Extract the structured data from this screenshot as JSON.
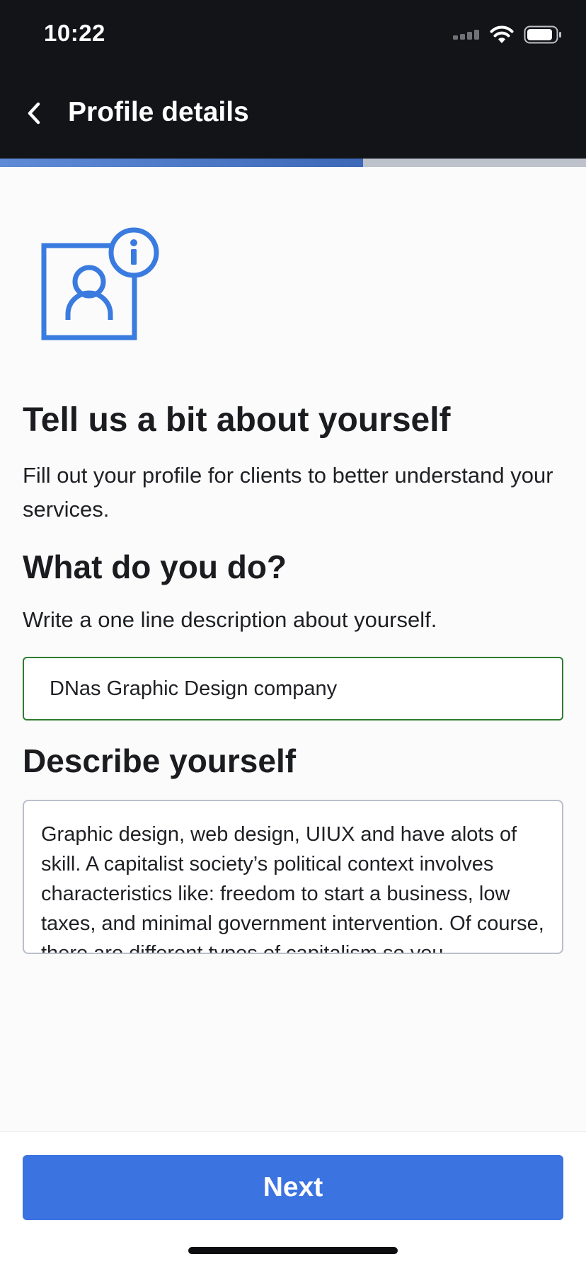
{
  "status_bar": {
    "time": "10:22"
  },
  "header": {
    "title": "Profile details",
    "back_icon": "chevron-left-icon"
  },
  "progress": {
    "fraction": 0.62,
    "fill_color": "#3d68b8",
    "track_color": "#bec2cb"
  },
  "hero": {
    "icon": "profile-info-icon",
    "color": "#3a7bdf"
  },
  "main": {
    "title": "Tell us a bit about yourself",
    "intro": "Fill out your profile for clients to better understand your services.",
    "what_heading": "What do you do?",
    "what_hint": "Write a one line description about yourself.",
    "what_value": "DNas Graphic Design company",
    "describe_heading": "Describe yourself",
    "describe_value": "Graphic design, web design, UIUX and have alots of skill. A capitalist society’s political context involves characteristics like: freedom to start a business, low taxes, and minimal government intervention. Of course, there are different types of capitalism so you"
  },
  "footer": {
    "next_label": "Next",
    "accent": "#3b73e0"
  }
}
